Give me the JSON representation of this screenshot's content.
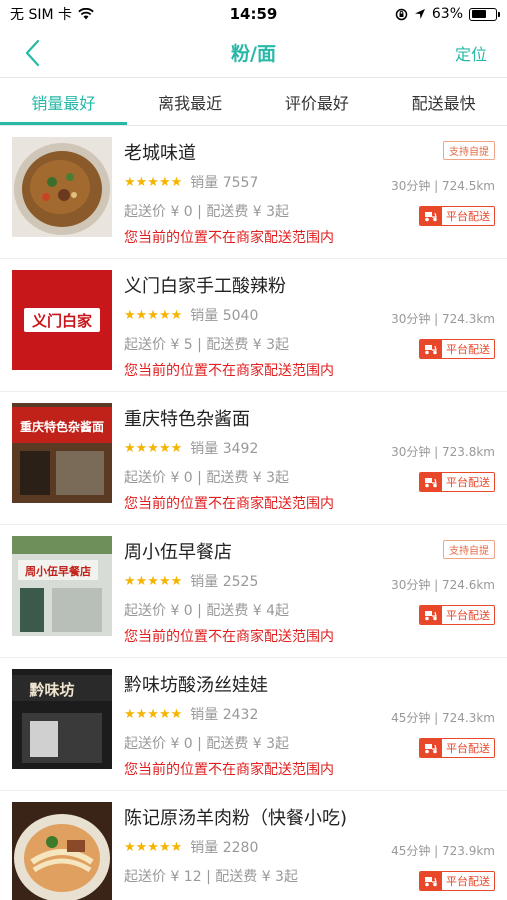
{
  "status": {
    "carrier": "无 SIM 卡",
    "time": "14:59",
    "battery": "63%",
    "battery_level": 0.63
  },
  "nav": {
    "title": "粉/面",
    "right": "定位"
  },
  "tabs": [
    {
      "label": "销量最好"
    },
    {
      "label": "离我最近"
    },
    {
      "label": "评价最好"
    },
    {
      "label": "配送最快"
    }
  ],
  "common": {
    "sales_label": "销量",
    "warning": "您当前的位置不在商家配送范围内",
    "self_pick": "支持自提",
    "platform": "平台配送",
    "stars": "★★★★★"
  },
  "stores": [
    {
      "name": "老城味道",
      "sales": "7557",
      "fees": "起送价 ¥ 0 | 配送费 ¥ 3起",
      "time_dist": "30分钟 | 724.5km",
      "self_pick": true
    },
    {
      "name": "义门白家手工酸辣粉",
      "sales": "5040",
      "fees": "起送价 ¥ 5 | 配送费 ¥ 3起",
      "time_dist": "30分钟 | 724.3km",
      "self_pick": false
    },
    {
      "name": "重庆特色杂酱面",
      "sales": "3492",
      "fees": "起送价 ¥ 0 | 配送费 ¥ 3起",
      "time_dist": "30分钟 | 723.8km",
      "self_pick": false
    },
    {
      "name": "周小伍早餐店",
      "sales": "2525",
      "fees": "起送价 ¥ 0 | 配送费 ¥ 4起",
      "time_dist": "30分钟 | 724.6km",
      "self_pick": true
    },
    {
      "name": "黔味坊酸汤丝娃娃",
      "sales": "2432",
      "fees": "起送价 ¥ 0 | 配送费 ¥ 3起",
      "time_dist": "45分钟 | 724.3km",
      "self_pick": false
    },
    {
      "name": "陈记原汤羊肉粉（快餐小吃)",
      "sales": "2280",
      "fees": "起送价 ¥ 12 | 配送费 ¥ 3起",
      "time_dist": "45分钟 | 723.9km",
      "self_pick": false
    }
  ],
  "thumb_text": {
    "s2": "义门白家",
    "s3": "重庆特色杂酱面",
    "s4": "周小伍早餐店",
    "s5": "黔味坊"
  },
  "colors": {
    "accent": "#27b8a8",
    "warning": "#e02020",
    "platform": "#e8472a",
    "star": "#f5b400"
  }
}
